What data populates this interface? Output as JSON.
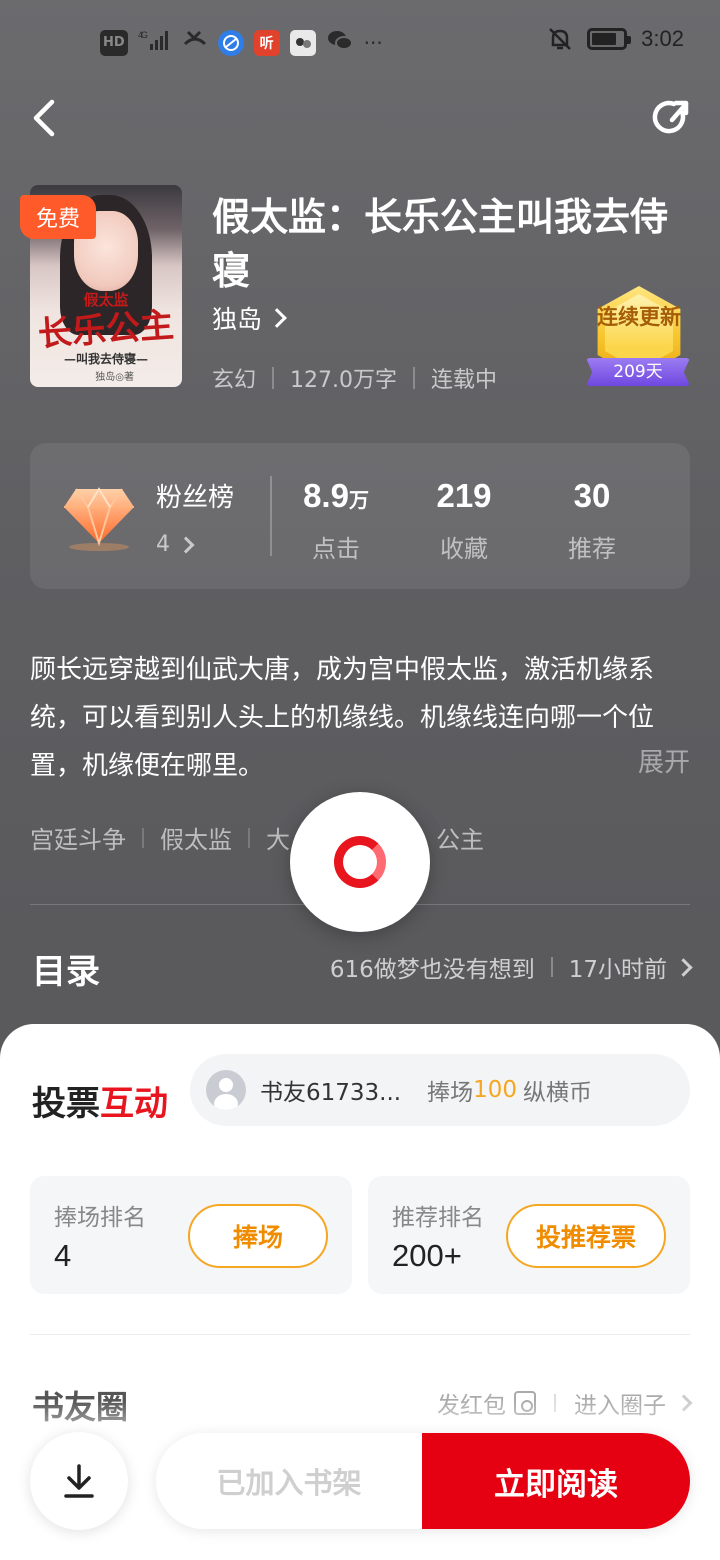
{
  "status_bar": {
    "network": "HD",
    "signal": "4G",
    "time": "3:02",
    "more": "···",
    "app_icons": [
      "browser-icon",
      "ting-icon",
      "comic-icon",
      "wechat-icon"
    ],
    "app2_label": "听"
  },
  "nav": {
    "back_icon": "chevron-left-icon",
    "share_icon": "share-icon"
  },
  "book": {
    "free_badge": "免费",
    "title": "假太监：长乐公主叫我去侍寝",
    "author": "独岛",
    "genre": "玄幻",
    "word_count": "127.0万字",
    "status": "连载中",
    "cover": {
      "line1": "假太监",
      "line2": "长乐公主",
      "line3": "—叫我去侍寝—",
      "author": "独岛◎著"
    },
    "update_badge": {
      "text": "连续更新",
      "days": "209天",
      "accent": "#f7c62d",
      "ribbon": "#7b55e6"
    }
  },
  "stats": {
    "fans_title": "粉丝榜",
    "fans_rank": "4",
    "clicks_value": "8.9",
    "clicks_unit": "万",
    "clicks_label": "点击",
    "favorites_value": "219",
    "favorites_label": "收藏",
    "recommend_value": "30",
    "recommend_label": "推荐"
  },
  "synopsis": {
    "text": "顾长远穿越到仙武大唐，成为宫中假太监，激活机缘系统，可以看到别人头上的机缘线。机缘线连向哪一个位置，机缘便在哪里。",
    "expand_label": "展开"
  },
  "tags": [
    "宫廷斗争",
    "假太监",
    "大",
    "公主"
  ],
  "toc": {
    "title": "目录",
    "latest_chapter": "616做梦也没有想到",
    "updated": "17小时前"
  },
  "interaction": {
    "title_black": "投票",
    "title_red": "互动",
    "ticker_user": "书友61733...",
    "ticker_action": "捧场",
    "ticker_amount": "100",
    "ticker_unit": "纵横币",
    "support_rank_label": "捧场排名",
    "support_rank_value": "4",
    "support_button": "捧场",
    "recommend_rank_label": "推荐排名",
    "recommend_rank_value": "200+",
    "recommend_button": "投推荐票"
  },
  "circle": {
    "title": "书友圈",
    "red_packet": "发红包",
    "enter": "进入圈子"
  },
  "actions": {
    "shelf_label": "已加入书架",
    "read_label": "立即阅读",
    "read_color": "#e50012"
  }
}
